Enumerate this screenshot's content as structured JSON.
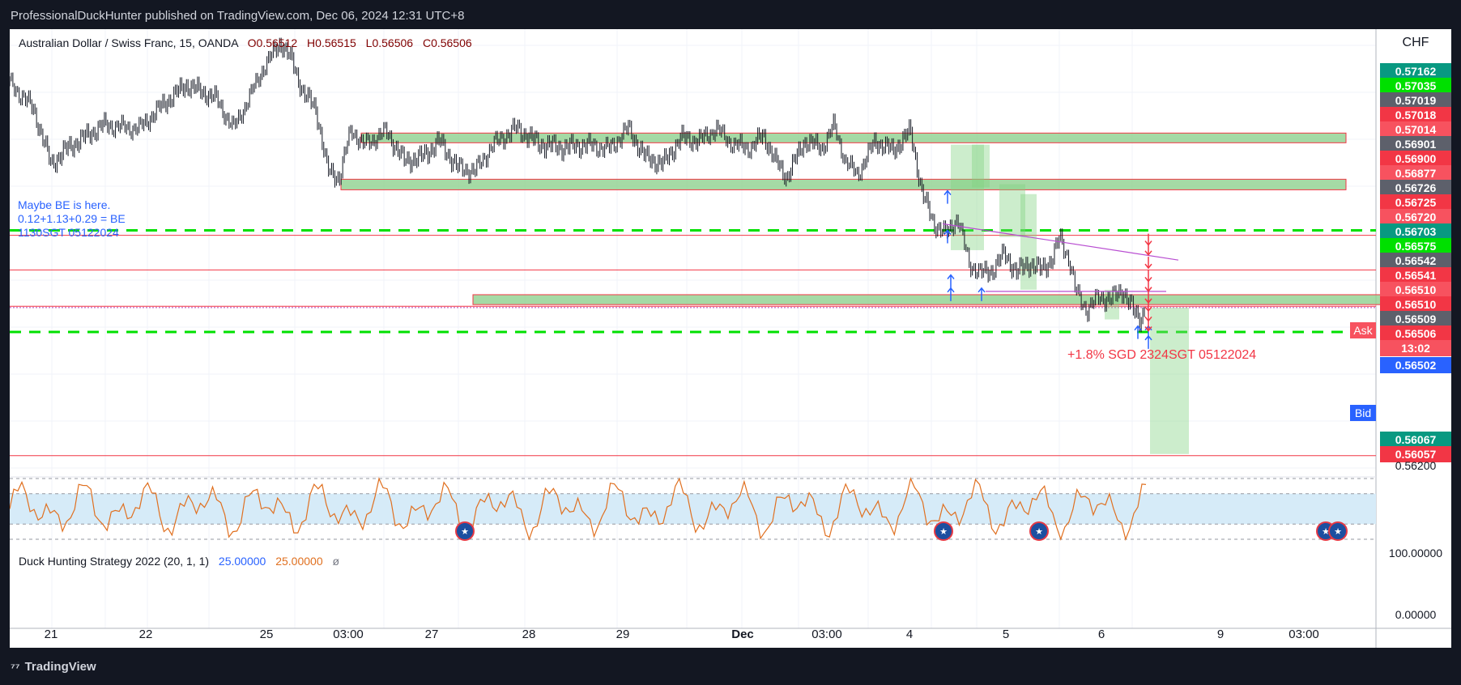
{
  "header": {
    "published": "ProfessionalDuckHunter published on TradingView.com, Dec 06, 2024 12:31 UTC+8"
  },
  "footer": {
    "brand": "TradingView"
  },
  "symbol": {
    "name": "Australian Dollar / Swiss Franc, 15, OANDA",
    "open": "O0.56512",
    "high": "H0.56515",
    "low": "L0.56506",
    "close": "C0.56506"
  },
  "indicator": {
    "title": "Duck Hunting Strategy 2022 (20, 1, 1)",
    "val1": "25.00000",
    "val2": "25.00000",
    "icon": "eye-off-icon"
  },
  "note": {
    "line1": "Maybe BE is here.",
    "line2": "0.12+1.13+0.29 = BE",
    "line3": "1130SGT 05122024"
  },
  "profit_note": "+1.8% SGD 2324SGT 05122024",
  "currency": "CHF",
  "colors": {
    "up": "#26a69a",
    "down": "#ef5350",
    "zone": "#8fd18f",
    "zone_border": "#f23645",
    "dash": "#00e000",
    "hline": "#f23645",
    "trend": "#b84dd1",
    "arrow_up": "#2962ff",
    "arrow_down": "#f23645",
    "osc": "#e07020",
    "osc_band": "#d6ebf8"
  },
  "price_labels": [
    {
      "text": "0.57162",
      "bg": "#089981"
    },
    {
      "text": "0.57035",
      "bg": "#00e000"
    },
    {
      "text": "0.57019",
      "bg": "#5d606b"
    },
    {
      "text": "0.57018",
      "bg": "#f23645"
    },
    {
      "text": "0.57014",
      "bg": "#f7525f"
    },
    {
      "text": "0.56901",
      "bg": "#5d606b"
    },
    {
      "text": "0.56900",
      "bg": "#f23645"
    },
    {
      "text": "0.56877",
      "bg": "#f7525f"
    },
    {
      "text": "0.56726",
      "bg": "#5d606b"
    },
    {
      "text": "0.56725",
      "bg": "#f23645"
    },
    {
      "text": "0.56720",
      "bg": "#f7525f"
    },
    {
      "text": "0.56703",
      "bg": "#089981"
    },
    {
      "text": "0.56575",
      "bg": "#00e000"
    },
    {
      "text": "0.56542",
      "bg": "#5d606b"
    },
    {
      "text": "0.56541",
      "bg": "#f23645"
    },
    {
      "text": "0.56510",
      "bg": "#f7525f"
    },
    {
      "text": "0.56510",
      "bg": "#f23645"
    },
    {
      "text": "0.56509",
      "bg": "#5d606b"
    },
    {
      "text": "0.56506",
      "bg": "#f23645"
    },
    {
      "text": "13:02",
      "bg": "#f7525f"
    },
    {
      "text": "0.56502",
      "bg": "#2962ff"
    },
    {
      "text": "0.56067",
      "bg": "#089981"
    },
    {
      "text": "0.56057",
      "bg": "#f23645"
    }
  ],
  "tags": {
    "ask": "Ask",
    "bid": "Bid"
  },
  "scale_ticks": {
    "price": "0.56200",
    "osc_top": "100.00000",
    "osc_bottom": "0.00000"
  },
  "chart_data": {
    "type": "candlestick",
    "title": "Australian Dollar / Swiss Franc, 15, OANDA",
    "xlabel": "",
    "ylabel": "",
    "x_ticks": [
      "21",
      "22",
      "25",
      "03:00",
      "27",
      "28",
      "29",
      "Dec",
      "03:00",
      "4",
      "5",
      "6",
      "9",
      "03:00"
    ],
    "price_path": [
      [
        0,
        0.5719
      ],
      [
        0.02,
        0.5711
      ],
      [
        0.035,
        0.5694
      ],
      [
        0.05,
        0.5699
      ],
      [
        0.08,
        0.5706
      ],
      [
        0.11,
        0.5705
      ],
      [
        0.13,
        0.5712
      ],
      [
        0.15,
        0.5718
      ],
      [
        0.175,
        0.5714
      ],
      [
        0.19,
        0.5705
      ],
      [
        0.2,
        0.5712
      ],
      [
        0.215,
        0.5723
      ],
      [
        0.23,
        0.5731
      ],
      [
        0.24,
        0.5725
      ],
      [
        0.25,
        0.5715
      ],
      [
        0.26,
        0.5711
      ],
      [
        0.27,
        0.5692
      ],
      [
        0.28,
        0.569
      ],
      [
        0.29,
        0.5705
      ],
      [
        0.3,
        0.57
      ],
      [
        0.32,
        0.5704
      ],
      [
        0.335,
        0.5695
      ],
      [
        0.35,
        0.5696
      ],
      [
        0.365,
        0.5701
      ],
      [
        0.38,
        0.5693
      ],
      [
        0.395,
        0.5692
      ],
      [
        0.41,
        0.57
      ],
      [
        0.43,
        0.5705
      ],
      [
        0.45,
        0.57
      ],
      [
        0.47,
        0.5699
      ],
      [
        0.49,
        0.57
      ],
      [
        0.51,
        0.5699
      ],
      [
        0.525,
        0.5705
      ],
      [
        0.54,
        0.5696
      ],
      [
        0.555,
        0.5694
      ],
      [
        0.57,
        0.5702
      ],
      [
        0.585,
        0.5701
      ],
      [
        0.6,
        0.5705
      ],
      [
        0.615,
        0.57
      ],
      [
        0.63,
        0.5699
      ],
      [
        0.64,
        0.5703
      ],
      [
        0.65,
        0.5695
      ],
      [
        0.66,
        0.569
      ],
      [
        0.675,
        0.5701
      ],
      [
        0.69,
        0.5699
      ],
      [
        0.7,
        0.5706
      ],
      [
        0.71,
        0.5695
      ],
      [
        0.72,
        0.5691
      ],
      [
        0.735,
        0.5701
      ],
      [
        0.75,
        0.5698
      ],
      [
        0.765,
        0.5704
      ],
      [
        0.775,
        0.5685
      ],
      [
        0.785,
        0.5676
      ],
      [
        0.795,
        0.5673
      ],
      [
        0.805,
        0.5678
      ],
      [
        0.815,
        0.5664
      ],
      [
        0.825,
        0.5661
      ],
      [
        0.835,
        0.5662
      ],
      [
        0.845,
        0.5667
      ],
      [
        0.855,
        0.5661
      ],
      [
        0.865,
        0.5664
      ],
      [
        0.875,
        0.5662
      ],
      [
        0.885,
        0.5665
      ],
      [
        0.892,
        0.5672
      ],
      [
        0.9,
        0.5665
      ],
      [
        0.905,
        0.5656
      ],
      [
        0.915,
        0.565
      ],
      [
        0.925,
        0.5654
      ],
      [
        0.935,
        0.5653
      ],
      [
        0.945,
        0.5656
      ],
      [
        0.955,
        0.5649
      ],
      [
        0.96,
        0.5647
      ],
      [
        0.965,
        0.56506
      ]
    ],
    "price_range": [
      0.56,
      0.5735
    ],
    "oscillator": {
      "name": "Duck Hunting Strategy 2022",
      "ylim": [
        0,
        100
      ],
      "band": [
        25,
        75
      ]
    },
    "zones": [
      {
        "from": 0.57006,
        "to": 0.57035
      },
      {
        "from": 0.56863,
        "to": 0.56895
      },
      {
        "from": 0.56515,
        "to": 0.56545
      }
    ],
    "horizontal_lines": [
      0.56725,
      0.5662,
      0.5651,
      0.56057
    ],
    "dashed_lines": [
      0.5674,
      0.56432
    ],
    "grid": true
  }
}
